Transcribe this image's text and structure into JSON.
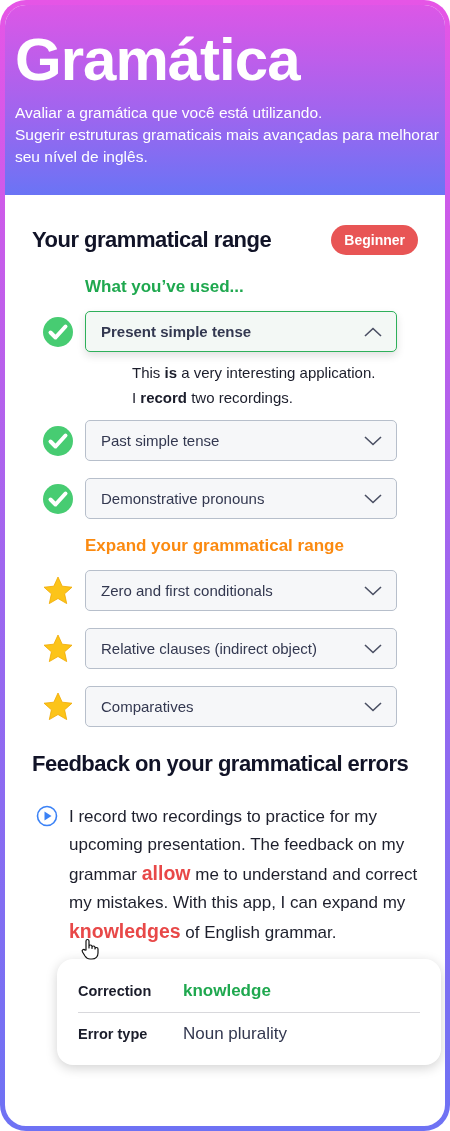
{
  "header": {
    "title": "Gramática",
    "description": [
      "Avaliar a gramática que você está utilizando.",
      "Sugerir estruturas gramaticais mais avançadas para melhorar seu nível de inglês."
    ]
  },
  "range": {
    "title": "Your grammatical range",
    "level_badge": "Beginner",
    "sections": [
      {
        "kind": "used",
        "title": "What you’ve used...",
        "items": [
          {
            "label": "Present simple tense",
            "expanded": true,
            "examples": [
              "This **is** a very interesting application.",
              "I **record** two recordings."
            ]
          },
          {
            "label": "Past simple tense",
            "expanded": false
          },
          {
            "label": "Demonstrative pronouns",
            "expanded": false
          }
        ]
      },
      {
        "kind": "expand",
        "title": "Expand your grammatical range",
        "items": [
          {
            "label": "Zero and first conditionals",
            "expanded": false
          },
          {
            "label": "Relative clauses (indirect object)",
            "expanded": false
          },
          {
            "label": "Comparatives",
            "expanded": false
          }
        ]
      }
    ]
  },
  "feedback": {
    "title": "Feedback on your grammatical errors",
    "segments": [
      {
        "kind": "plain",
        "text": "I record two recordings to practice for my upcoming presentation. The feedback on my grammar "
      },
      {
        "kind": "error",
        "text": "allow",
        "hovered": false
      },
      {
        "kind": "plain",
        "text": " me to understand and correct my mistakes. With this app, I can expand my "
      },
      {
        "kind": "error",
        "text": "knowledges",
        "hovered": true
      },
      {
        "kind": "plain",
        "text": " of English grammar."
      }
    ],
    "popup": {
      "rows": [
        {
          "label": "Correction",
          "value": "knowledge",
          "kind": "correction"
        },
        {
          "label": "Error type",
          "value": "Noun plurality",
          "kind": "type"
        }
      ]
    }
  }
}
